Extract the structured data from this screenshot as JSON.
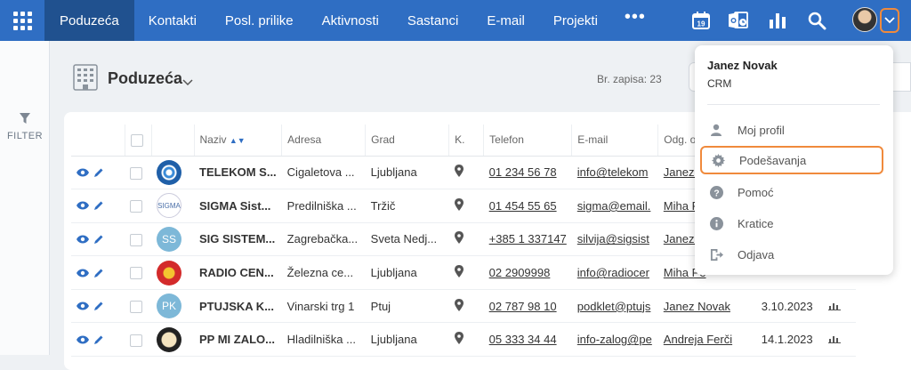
{
  "nav": {
    "items": [
      "Poduzeća",
      "Kontakti",
      "Posl. prilike",
      "Aktivnosti",
      "Sastanci",
      "E-mail",
      "Projekti"
    ],
    "more": "•••",
    "calendar_day": "19",
    "icons": [
      "calendar-icon",
      "outlook-icon",
      "reports-icon",
      "search-icon"
    ]
  },
  "sidebar": {
    "filter_label": "FILTER"
  },
  "page": {
    "title": "Poduzeća",
    "record_count": "Br. zapisa: 23"
  },
  "table": {
    "columns": [
      "Naziv",
      "Adresa",
      "Grad",
      "K.",
      "Telefon",
      "E-mail",
      "Odg. osoba",
      "",
      ""
    ],
    "rows": [
      {
        "logo": "telekom",
        "name": "TELEKOM S...",
        "address": "Cigaletova ...",
        "city": "Ljubljana",
        "phone": "01 234 56 78",
        "email": "info@telekom",
        "owner": "Janez N",
        "date": ""
      },
      {
        "logo": "sigma",
        "name": "SIGMA Sist...",
        "address": "Predilniška ...",
        "city": "Tržič",
        "phone": "01 454 55 65",
        "email": "sigma@email.",
        "owner": "Miha Pe",
        "date": ""
      },
      {
        "logo": "SS",
        "name": "SIG SISTEM...",
        "address": "Zagrebačka...",
        "city": "Sveta Nedj...",
        "phone": "+385 1 337147",
        "email": "silvija@sigsist",
        "owner": "Janez N",
        "date": ""
      },
      {
        "logo": "radio",
        "name": "RADIO CEN...",
        "address": "Železna ce...",
        "city": "Ljubljana",
        "phone": "02 2909998",
        "email": "info@radiocer",
        "owner": "Miha Pe",
        "date": ""
      },
      {
        "logo": "PK",
        "name": "PTUJSKA K...",
        "address": "Vinarski trg 1",
        "city": "Ptuj",
        "phone": "02 787 98 10",
        "email": "podklet@ptujs",
        "owner": "Janez Novak",
        "date": "3.10.2023"
      },
      {
        "logo": "pp",
        "name": "PP MI ZALO...",
        "address": "Hladilniška ...",
        "city": "Ljubljana",
        "phone": "05 333 34 44",
        "email": "info-zalog@pe",
        "owner": "Andreja Ferči",
        "date": "14.1.2023"
      }
    ]
  },
  "user_menu": {
    "name": "Janez Novak",
    "company": "CRM",
    "items": [
      {
        "label": "Moj profil",
        "icon": "user-icon"
      },
      {
        "label": "Podešavanja",
        "icon": "gear-icon"
      },
      {
        "label": "Pomoć",
        "icon": "help-icon"
      },
      {
        "label": "Kratice",
        "icon": "info-icon"
      },
      {
        "label": "Odjava",
        "icon": "logout-icon"
      }
    ]
  },
  "colors": {
    "topbar": "#2f6ec3",
    "active_tab": "#20518f",
    "highlight": "#f08a3c",
    "link_icon": "#2f6ec3"
  }
}
